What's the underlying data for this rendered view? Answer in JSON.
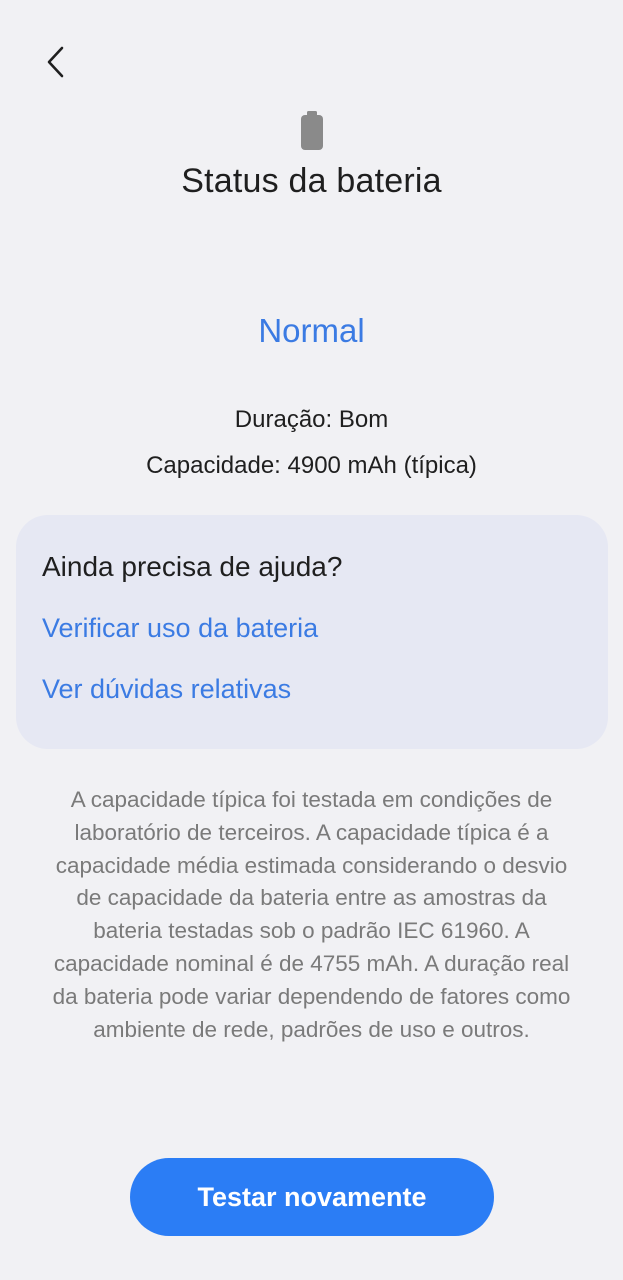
{
  "header": {
    "back_icon": "chevron-left-icon",
    "battery_icon": "battery-icon",
    "title": "Status da bateria"
  },
  "status": {
    "value": "Normal",
    "duration": "Duração: Bom",
    "capacity": "Capacidade: 4900 mAh (típica)"
  },
  "help": {
    "title": "Ainda precisa de ajuda?",
    "links": [
      "Verificar uso da bateria",
      "Ver dúvidas relativas"
    ]
  },
  "disclaimer": "A capacidade típica foi testada em condições de laboratório de terceiros. A capacidade típica é a capacidade média estimada considerando o desvio de capacidade da bateria entre as amostras da bateria testadas sob o padrão IEC 61960. A capacidade nominal é de 4755 mAh. A duração real da bateria pode variar dependendo de fatores como ambiente de rede, padrões de uso e outros.",
  "actions": {
    "retest_label": "Testar novamente"
  },
  "colors": {
    "accent": "#3b7be3",
    "button": "#2b7df5",
    "background": "#f1f1f4",
    "card": "#e6e8f3"
  }
}
